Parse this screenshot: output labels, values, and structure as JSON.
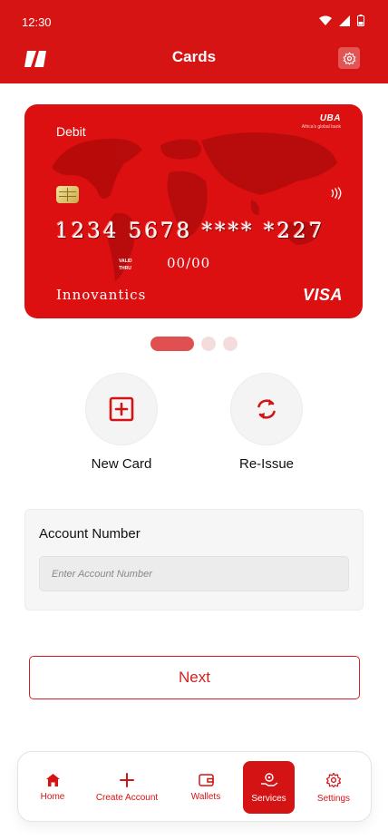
{
  "status_bar": {
    "time": "12:30"
  },
  "header": {
    "title": "Cards"
  },
  "card": {
    "type": "Debit",
    "bank_name": "UBA",
    "bank_tagline": "Africa's global bank",
    "number": "1234 5678 **** *227",
    "valid_label_1": "VALID",
    "valid_label_2": "THRU",
    "expiry": "00/00",
    "holder": "Innovantics",
    "brand": "VISA",
    "color": "#dc1010"
  },
  "carousel": {
    "page_count": 3,
    "active_index": 0
  },
  "actions": [
    {
      "label": "New Card",
      "icon": "plus-square-icon"
    },
    {
      "label": "Re-Issue",
      "icon": "refresh-icon"
    }
  ],
  "account": {
    "label": "Account Number",
    "value": "",
    "placeholder": "Enter Account Number"
  },
  "next_button": {
    "label": "Next"
  },
  "bottom_nav": [
    {
      "label": "Home",
      "icon": "home-icon",
      "active": false
    },
    {
      "label": "Create Account",
      "icon": "plus-icon",
      "active": false
    },
    {
      "label": "Wallets",
      "icon": "wallet-icon",
      "active": false
    },
    {
      "label": "Services",
      "icon": "services-icon",
      "active": true
    },
    {
      "label": "Settings",
      "icon": "gear-icon",
      "active": false
    }
  ],
  "colors": {
    "primary": "#d71414",
    "accent_light": "#f4dcdc",
    "dot_active": "#e05050"
  }
}
